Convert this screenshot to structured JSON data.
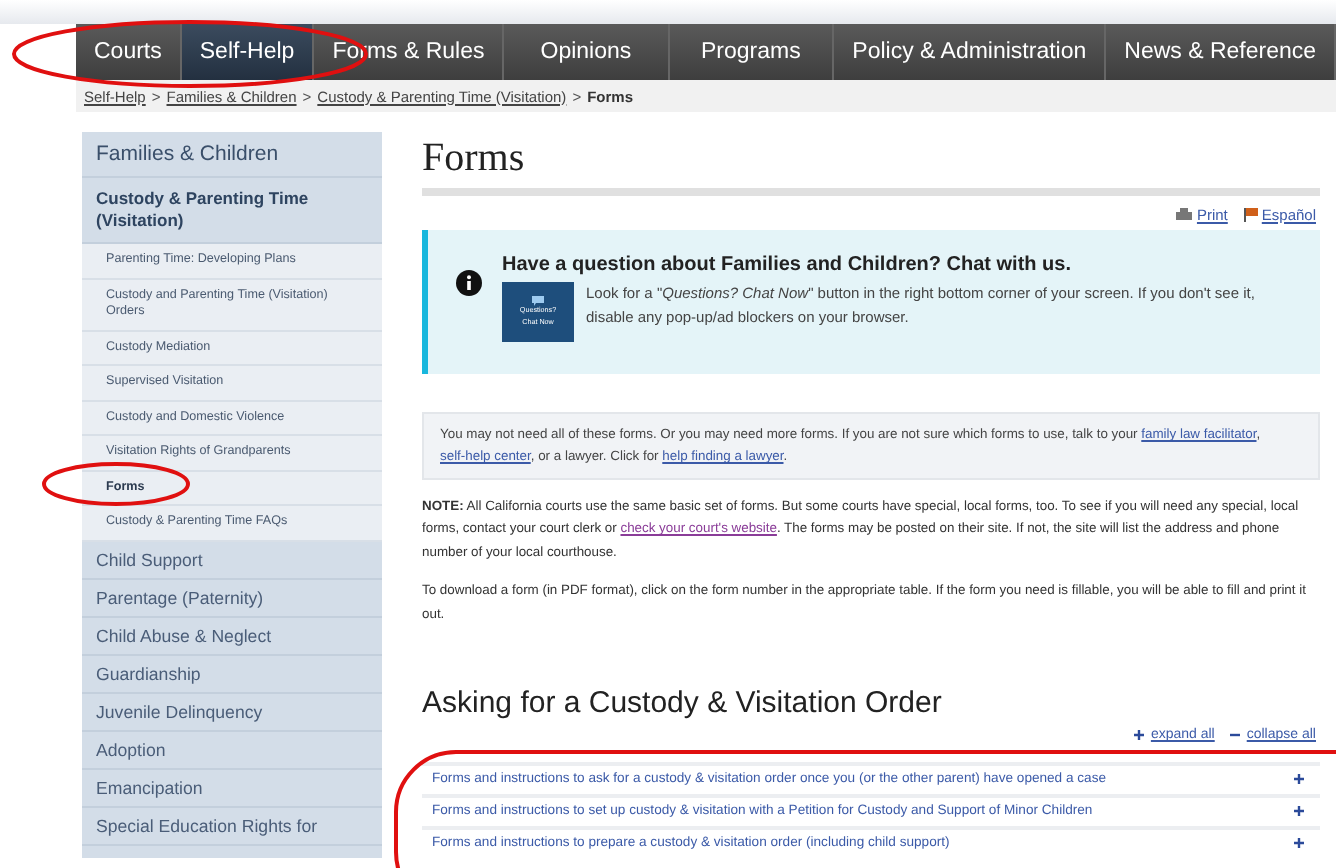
{
  "nav": {
    "items": [
      {
        "label": "Courts",
        "selected": false
      },
      {
        "label": "Self-Help",
        "selected": true
      },
      {
        "label": "Forms & Rules",
        "selected": false
      },
      {
        "label": "Opinions",
        "selected": false
      },
      {
        "label": "Programs",
        "selected": false
      },
      {
        "label": "Policy & Administration",
        "selected": false
      },
      {
        "label": "News & Reference",
        "selected": false
      }
    ]
  },
  "breadcrumb": {
    "links": [
      "Self-Help",
      "Families & Children",
      "Custody & Parenting Time (Visitation)"
    ],
    "separator": ">",
    "current": "Forms"
  },
  "sidebar": {
    "title": "Families & Children",
    "section": "Custody & Parenting Time (Visitation)",
    "subitems": [
      {
        "label": "Parenting Time: Developing Plans",
        "selected": false
      },
      {
        "label": "Custody and Parenting Time (Visitation) Orders",
        "selected": false
      },
      {
        "label": "Custody Mediation",
        "selected": false
      },
      {
        "label": "Supervised Visitation",
        "selected": false
      },
      {
        "label": "Custody and Domestic Violence",
        "selected": false
      },
      {
        "label": "Visitation Rights of Grandparents",
        "selected": false
      },
      {
        "label": "Forms",
        "selected": true
      },
      {
        "label": "Custody & Parenting Time FAQs",
        "selected": false
      }
    ],
    "items": [
      "Child Support",
      "Parentage (Paternity)",
      "Child Abuse & Neglect",
      "Guardianship",
      "Juvenile Delinquency",
      "Adoption",
      "Emancipation",
      "Special Education Rights for"
    ]
  },
  "page": {
    "title": "Forms",
    "print": "Print",
    "language": "Español",
    "chat": {
      "heading": "Have a question about Families and Children? Chat with us.",
      "button_lines": [
        "Questions?",
        "Chat Now"
      ],
      "text": "Look for a \"*Questions? Chat Now*\" button in the right bottom corner of your screen. If you don't see it, disable any pop-up/ad blockers on your browser."
    },
    "notice": [
      {
        "kind": "text",
        "text": "You may not need all of these forms. Or you may need more forms. If you are not sure which forms to use, talk to your "
      },
      {
        "kind": "link",
        "text": "family law facilitator"
      },
      {
        "kind": "text",
        "text": ", "
      },
      {
        "kind": "link",
        "text": "self-help center"
      },
      {
        "kind": "text",
        "text": ", or a lawyer. Click for "
      },
      {
        "kind": "link",
        "text": "help finding a lawyer"
      },
      {
        "kind": "text",
        "text": "."
      }
    ],
    "note": [
      {
        "kind": "text",
        "text": "**NOTE:** All California courts use the same basic set of forms. But some courts have special, local forms, too. To see if you will need any special, local forms, contact your court clerk or "
      },
      {
        "kind": "link",
        "text": "check your court's website"
      },
      {
        "kind": "text",
        "text": ". The forms may be posted on their site. If not, the site will list the address and phone number of your local courthouse."
      }
    ],
    "download": "To download a form (in PDF format), click on the form number in the appropriate table. If the form you need is fillable, you will be able to fill and print it out.",
    "section_title": "Asking for a Custody & Visitation Order",
    "expand_all": "expand all",
    "collapse_all": "collapse all",
    "rows": [
      {
        "label": "Forms and instructions to ask for a custody & visitation order once you (or the other parent) have opened a case",
        "expanded": false
      },
      {
        "label": "Forms and instructions to set up custody & visitation with a Petition for Custody and Support of Minor Children",
        "expanded": false
      },
      {
        "label": "Forms and instructions to prepare a custody & visitation order (including child support)",
        "expanded": false
      }
    ]
  }
}
